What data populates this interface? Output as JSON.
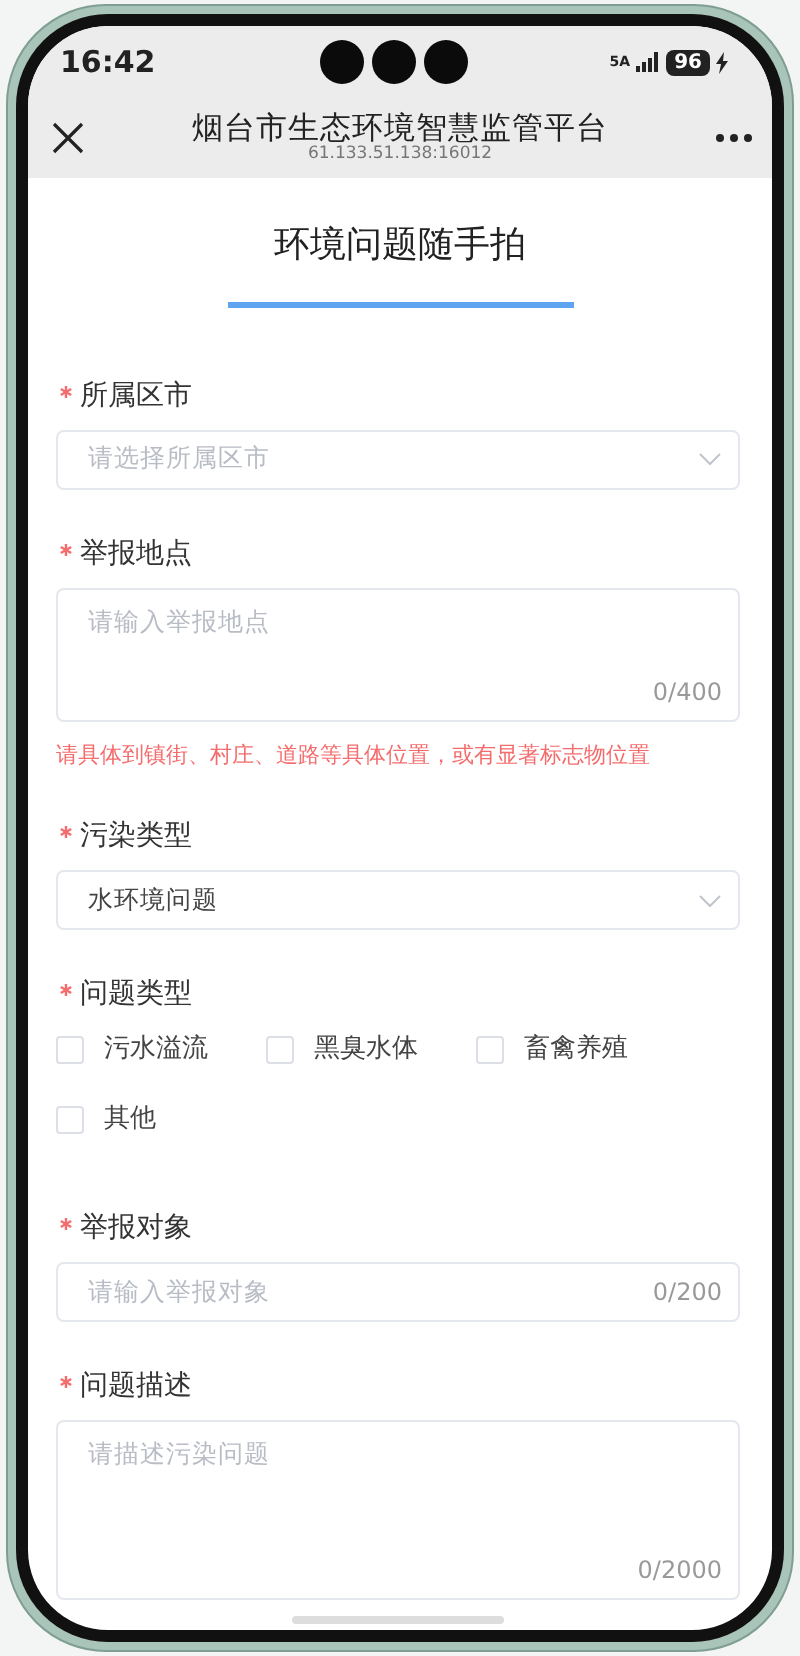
{
  "status_bar": {
    "time": "16:42",
    "network": "5A",
    "battery": "96"
  },
  "header": {
    "title": "烟台市生态环境智慧监管平台",
    "url": "61.133.51.138:16012"
  },
  "page_title": "环境问题随手拍",
  "fields": [
    {
      "kind": "select",
      "label": "所属区市",
      "required": true,
      "placeholder": "请选择所属区市"
    },
    {
      "kind": "textarea",
      "label": "举报地点",
      "required": true,
      "placeholder": "请输入举报地点",
      "counter": "0/400",
      "hint": "请具体到镇街、村庄、道路等具体位置，或有显著标志物位置"
    },
    {
      "kind": "select",
      "label": "污染类型",
      "required": true,
      "value": "水环境问题"
    },
    {
      "kind": "checkboxes",
      "label": "问题类型",
      "required": true,
      "options": [
        {
          "label": "污水溢流",
          "checked": false
        },
        {
          "label": "黑臭水体",
          "checked": false
        },
        {
          "label": "畜禽养殖",
          "checked": false
        },
        {
          "label": "其他",
          "checked": false
        }
      ]
    },
    {
      "kind": "input",
      "label": "举报对象",
      "required": true,
      "placeholder": "请输入举报对象",
      "counter": "0/200"
    },
    {
      "kind": "textarea",
      "label": "问题描述",
      "required": true,
      "placeholder": "请描述污染问题",
      "counter": "0/2000"
    }
  ]
}
